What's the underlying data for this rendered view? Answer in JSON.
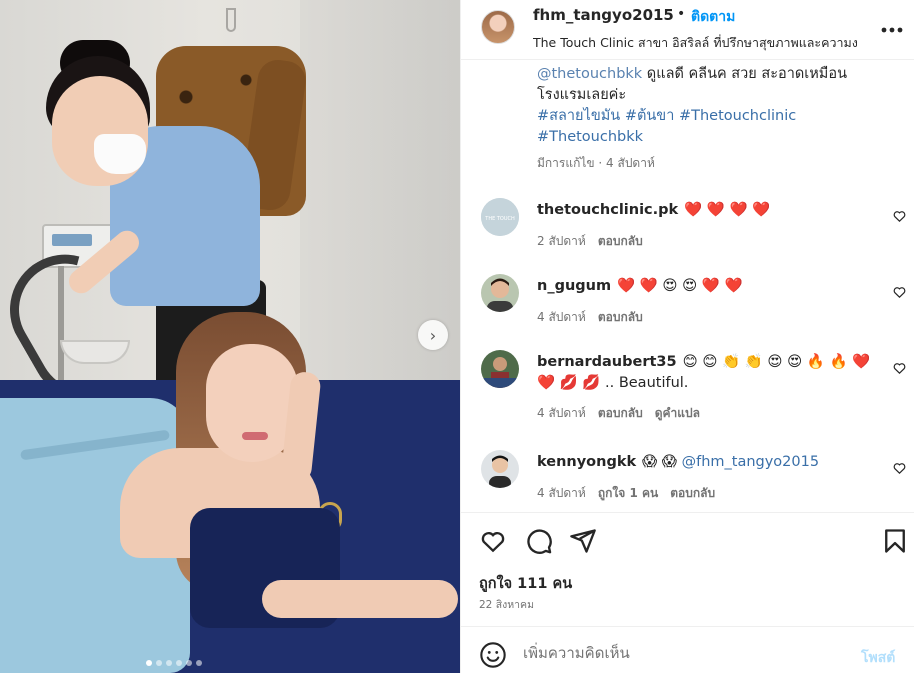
{
  "post": {
    "carousel": {
      "slide_count": 6,
      "active_index": 0
    }
  },
  "header": {
    "username": "fhm_tangyo2015",
    "separator": "•",
    "follow_label": "ติดตาม",
    "location": "The Touch Clinic สาขา อิสริลล์ ที่ปรึกษาสุขภาพและความง",
    "more_icon": "more-horizontal-icon"
  },
  "caption": {
    "line1_mention": "@thetouchbkk",
    "line1_text": " ดูแลดี คลีนค สวย สะอาดเหมือน",
    "line2": "โรงแรมเลยค่ะ",
    "tags_line1": [
      "#สลายไขมัน",
      "#ต้นขา",
      "#Thetouchclinic"
    ],
    "tags_line2": [
      "#Thetouchbkk"
    ],
    "edited": "มีการแก้ไข · 4 สัปดาห์"
  },
  "comments": [
    {
      "username": "thetouchclinic.pk",
      "text": "❤️ ❤️ ❤️ ❤️",
      "time": "2 สัปดาห์",
      "reply": "ตอบกลับ",
      "likes": "",
      "translate": ""
    },
    {
      "username": "n_gugum",
      "text": "❤️ ❤️ 😍 😍 ❤️ ❤️",
      "time": "4 สัปดาห์",
      "reply": "ตอบกลับ",
      "likes": "",
      "translate": ""
    },
    {
      "username": "bernardaubert35",
      "text": "😊 😊 👏 👏 😍 😍 🔥 🔥 ❤️ ❤️ 💋 💋 .. Beautiful.",
      "time": "4 สัปดาห์",
      "reply": "ตอบกลับ",
      "likes": "",
      "translate": "ดูคำแปล"
    },
    {
      "username": "kennyongkk",
      "text": "😱 😱 ",
      "mention": "@fhm_tangyo2015",
      "time": "4 สัปดาห์",
      "reply": "ตอบกลับ",
      "likes": "ถูกใจ 1 คน",
      "translate": ""
    }
  ],
  "footer": {
    "likes": "ถูกใจ 111 คน",
    "date": "22 สิงหาคม",
    "add_comment_placeholder": "เพิ่มความคิดเห็น",
    "post_label": "โพสต์"
  },
  "colors": {
    "link_blue": "#0095f6",
    "hashtag_blue": "#3a6fa8",
    "post_disabled": "#b2dffc",
    "meta_gray": "#737373"
  }
}
